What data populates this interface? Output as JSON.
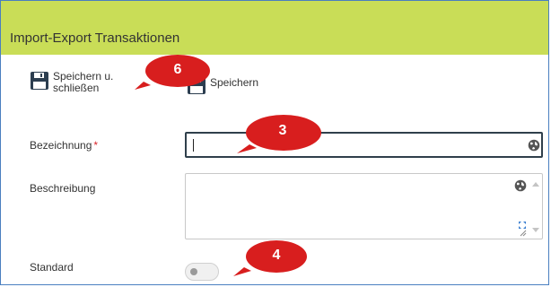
{
  "window": {
    "title": "Import-Export Transaktionen"
  },
  "toolbar": {
    "save_close_label_line1": "Speichern u.",
    "save_close_label_line2": "schließen",
    "save_label": "Speichern"
  },
  "form": {
    "bezeichnung": {
      "label": "Bezeichnung",
      "required_marker": "*",
      "value": ""
    },
    "beschreibung": {
      "label": "Beschreibung",
      "value": ""
    },
    "standard": {
      "label": "Standard",
      "checked": false
    }
  },
  "callouts": [
    {
      "number": "6"
    },
    {
      "number": "3"
    },
    {
      "number": "4"
    }
  ],
  "colors": {
    "header_bg": "#c9dd57",
    "callout_red": "#d81e1e",
    "frame_border": "#4a7fc0"
  }
}
